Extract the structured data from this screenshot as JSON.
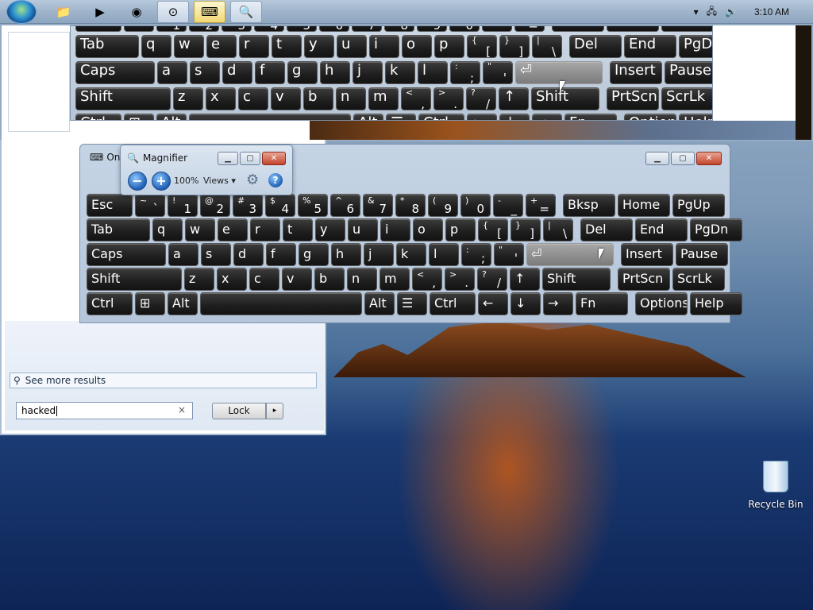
{
  "taskbar": {
    "start_icon": "windows-start-orb",
    "pinned": [
      {
        "name": "explorer",
        "icon": "folder-icon",
        "glyph": "📁"
      },
      {
        "name": "media-player",
        "icon": "media-player-icon",
        "glyph": "▶"
      },
      {
        "name": "chrome",
        "icon": "chrome-icon",
        "glyph": "◉"
      },
      {
        "name": "steam",
        "icon": "steam-icon",
        "glyph": "⊙"
      },
      {
        "name": "on-screen-keyboard",
        "icon": "keyboard-icon",
        "glyph": "⌨"
      },
      {
        "name": "magnifier",
        "icon": "magnifier-icon",
        "glyph": "🔍"
      }
    ],
    "tray": {
      "clock": "3:10 AM",
      "icons": [
        "chevron-up-icon",
        "network-icon",
        "volume-icon"
      ]
    }
  },
  "osk": {
    "title": "On-",
    "rows": [
      [
        {
          "t": "Esc"
        },
        {
          "s": "~",
          "b": "`"
        },
        {
          "s": "!",
          "b": "1"
        },
        {
          "s": "@",
          "b": "2"
        },
        {
          "s": "#",
          "b": "3"
        },
        {
          "s": "$",
          "b": "4"
        },
        {
          "s": "%",
          "b": "5"
        },
        {
          "s": "^",
          "b": "6"
        },
        {
          "s": "&",
          "b": "7"
        },
        {
          "s": "*",
          "b": "8"
        },
        {
          "s": "(",
          "b": "9"
        },
        {
          "s": ")",
          "b": "0"
        },
        {
          "s": "-",
          "b": "_"
        },
        {
          "s": "+",
          "b": "="
        },
        {
          "t": "Bksp"
        },
        {
          "t": "Home"
        },
        {
          "t": "PgUp"
        }
      ],
      [
        {
          "t": "Tab"
        },
        {
          "t": "q"
        },
        {
          "t": "w"
        },
        {
          "t": "e"
        },
        {
          "t": "r"
        },
        {
          "t": "t"
        },
        {
          "t": "y"
        },
        {
          "t": "u"
        },
        {
          "t": "i"
        },
        {
          "t": "o"
        },
        {
          "t": "p"
        },
        {
          "s": "{",
          "b": "["
        },
        {
          "s": "}",
          "b": "]"
        },
        {
          "s": "|",
          "b": "\\"
        },
        {
          "t": "Del"
        },
        {
          "t": "End"
        },
        {
          "t": "PgDn"
        }
      ],
      [
        {
          "t": "Caps"
        },
        {
          "t": "a"
        },
        {
          "t": "s"
        },
        {
          "t": "d"
        },
        {
          "t": "f"
        },
        {
          "t": "g"
        },
        {
          "t": "h"
        },
        {
          "t": "j"
        },
        {
          "t": "k"
        },
        {
          "t": "l"
        },
        {
          "s": ":",
          "b": ";"
        },
        {
          "s": "\"",
          "b": "'"
        },
        {
          "t": "⏎",
          "enter": true
        },
        {
          "t": "Insert"
        },
        {
          "t": "Pause"
        }
      ],
      [
        {
          "t": "Shift"
        },
        {
          "t": "z"
        },
        {
          "t": "x"
        },
        {
          "t": "c"
        },
        {
          "t": "v"
        },
        {
          "t": "b"
        },
        {
          "t": "n"
        },
        {
          "t": "m"
        },
        {
          "s": "<",
          "b": ","
        },
        {
          "s": ">",
          "b": "."
        },
        {
          "s": "?",
          "b": "/"
        },
        {
          "t": "↑"
        },
        {
          "t": "Shift"
        },
        {
          "t": "PrtScn"
        },
        {
          "t": "ScrLk"
        }
      ],
      [
        {
          "t": "Ctrl"
        },
        {
          "t": "⊞"
        },
        {
          "t": "Alt"
        },
        {
          "t": ""
        },
        {
          "t": "Alt"
        },
        {
          "t": "☰"
        },
        {
          "t": "Ctrl"
        },
        {
          "t": "←"
        },
        {
          "t": "↓"
        },
        {
          "t": "→"
        },
        {
          "t": "Fn"
        },
        {
          "t": "Options"
        },
        {
          "t": "Help"
        }
      ]
    ]
  },
  "magnifier": {
    "title": "Magnifier",
    "zoom_out": "−",
    "zoom_in": "+",
    "zoom_level": "100%",
    "views_label": "Views",
    "views_arrow": "▾",
    "settings_icon": "gear-icon",
    "help_icon": "?"
  },
  "start_menu": {
    "see_more": "See more results",
    "search_value": "hacked",
    "clear_glyph": "×",
    "power_button": "Lock",
    "power_arrow": "▸"
  },
  "desktop": {
    "recycle_bin": "Recycle Bin"
  },
  "window_buttons": {
    "min": "▁",
    "max": "▢",
    "close": "✕"
  }
}
